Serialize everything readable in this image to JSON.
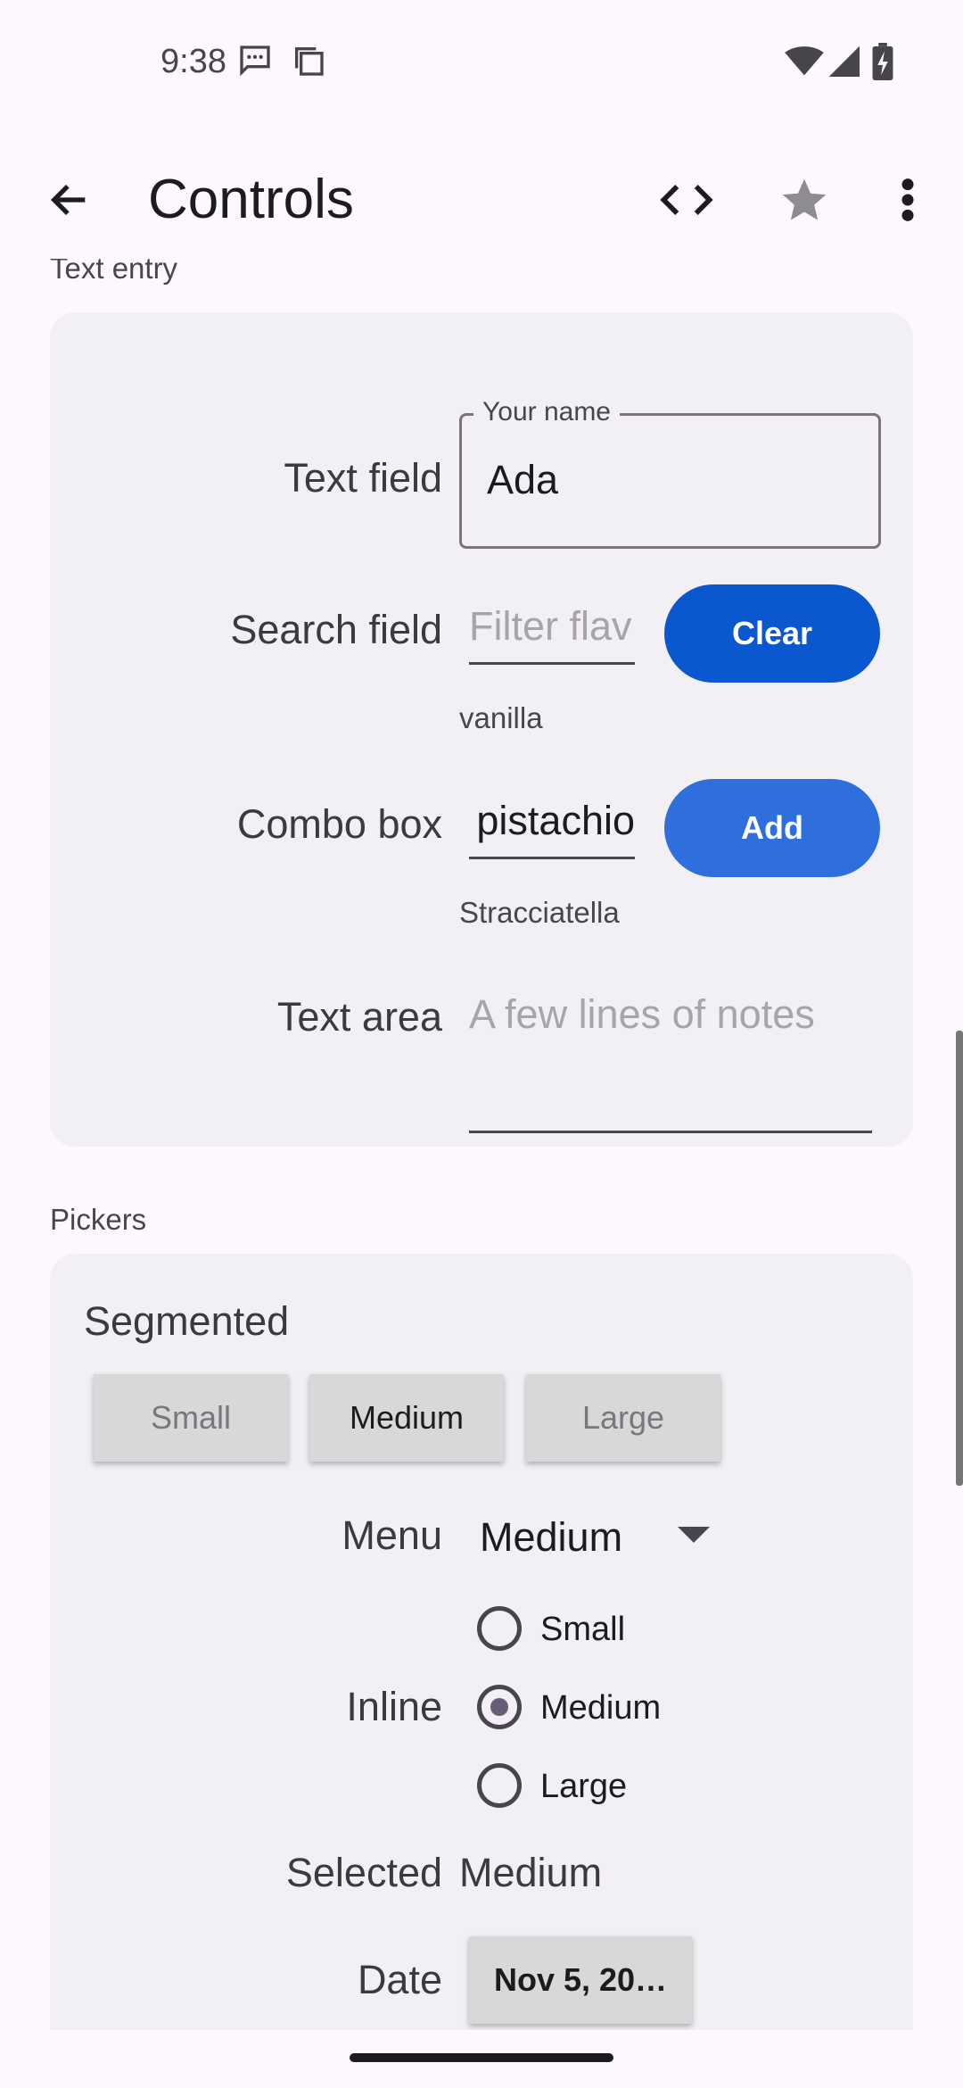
{
  "status_bar": {
    "time": "9:38",
    "icons": [
      "message-icon",
      "copy-icon",
      "wifi-icon",
      "signal-icon",
      "battery-charging-icon"
    ]
  },
  "app_bar": {
    "title": "Controls",
    "icons": [
      "back-arrow-icon",
      "code-icon",
      "star-icon",
      "more-vert-icon"
    ]
  },
  "text_entry": {
    "section_label": "Text entry",
    "text_field": {
      "label": "Text field",
      "floating_label": "Your name",
      "value": "Ada"
    },
    "search_field": {
      "label": "Search field",
      "placeholder": "Filter flav",
      "button": "Clear",
      "result": "vanilla"
    },
    "combo_box": {
      "label": "Combo box",
      "value": "pistachio",
      "button": "Add",
      "result": "Stracciatella"
    },
    "text_area": {
      "label": "Text area",
      "placeholder": "A few lines of notes"
    }
  },
  "pickers": {
    "section_label": "Pickers",
    "segmented": {
      "title": "Segmented",
      "options": [
        "Small",
        "Medium",
        "Large"
      ],
      "selected": "Medium"
    },
    "menu": {
      "label": "Menu",
      "value": "Medium"
    },
    "inline": {
      "label": "Inline",
      "options": [
        "Small",
        "Medium",
        "Large"
      ],
      "selected": "Medium"
    },
    "selected": {
      "label": "Selected",
      "value": "Medium"
    },
    "date": {
      "label": "Date",
      "value": "Nov 5, 20…"
    }
  },
  "colors": {
    "clear_button": "#0b57d0",
    "add_button": "#2f6fdd",
    "background": "#fdf8fd",
    "card": "#f2eff5"
  }
}
